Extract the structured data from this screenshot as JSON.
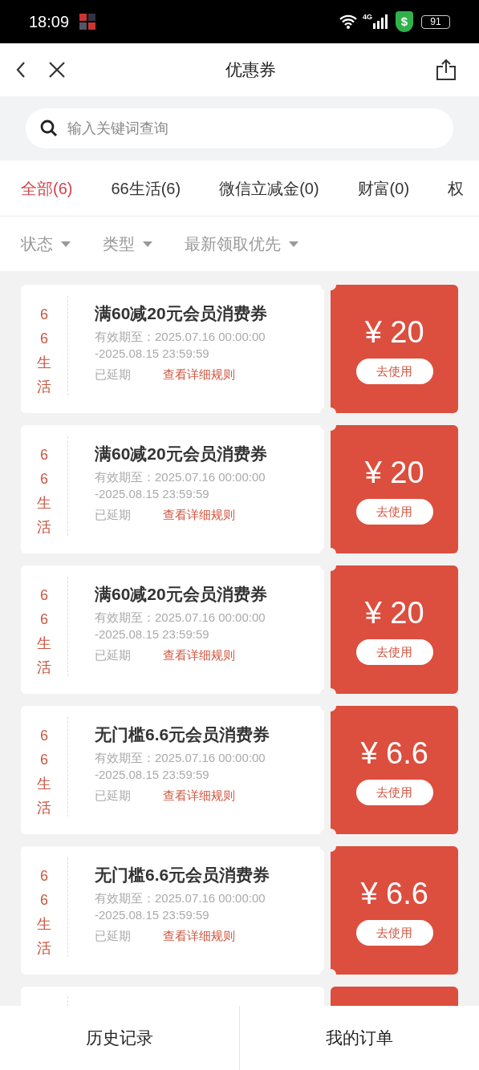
{
  "status_bar": {
    "time": "18:09",
    "network": "4G",
    "shield": "$",
    "battery": "91"
  },
  "nav": {
    "title": "优惠券"
  },
  "search": {
    "placeholder": "输入关键词查询"
  },
  "tabs": [
    {
      "label": "全部(6)",
      "selected": true
    },
    {
      "label": "66生活(6)",
      "selected": false
    },
    {
      "label": "微信立减金(0)",
      "selected": false
    },
    {
      "label": "财富(0)",
      "selected": false
    },
    {
      "label": "权",
      "selected": false
    }
  ],
  "filters": [
    "状态",
    "类型",
    "最新领取优先"
  ],
  "coupons": [
    {
      "brand": "66生活",
      "title": "满60减20元会员消费券",
      "valid_from": "有效期至：2025.07.16 00:00:00",
      "valid_to": "-2025.08.15 23:59:59",
      "status": "已延期",
      "rules_link": "查看详细规则",
      "price": "¥ 20",
      "button": "去使用"
    },
    {
      "brand": "66生活",
      "title": "满60减20元会员消费券",
      "valid_from": "有效期至：2025.07.16 00:00:00",
      "valid_to": "-2025.08.15 23:59:59",
      "status": "已延期",
      "rules_link": "查看详细规则",
      "price": "¥ 20",
      "button": "去使用"
    },
    {
      "brand": "66生活",
      "title": "满60减20元会员消费券",
      "valid_from": "有效期至：2025.07.16 00:00:00",
      "valid_to": "-2025.08.15 23:59:59",
      "status": "已延期",
      "rules_link": "查看详细规则",
      "price": "¥ 20",
      "button": "去使用"
    },
    {
      "brand": "66生活",
      "title": "无门槛6.6元会员消费券",
      "valid_from": "有效期至：2025.07.16 00:00:00",
      "valid_to": "-2025.08.15 23:59:59",
      "status": "已延期",
      "rules_link": "查看详细规则",
      "price": "¥ 6.6",
      "button": "去使用"
    },
    {
      "brand": "66生活",
      "title": "无门槛6.6元会员消费券",
      "valid_from": "有效期至：2025.07.16 00:00:00",
      "valid_to": "-2025.08.15 23:59:59",
      "status": "已延期",
      "rules_link": "查看详细规则",
      "price": "¥ 6.6",
      "button": "去使用"
    }
  ],
  "bottom_bar": [
    "历史记录",
    "我的订单"
  ]
}
